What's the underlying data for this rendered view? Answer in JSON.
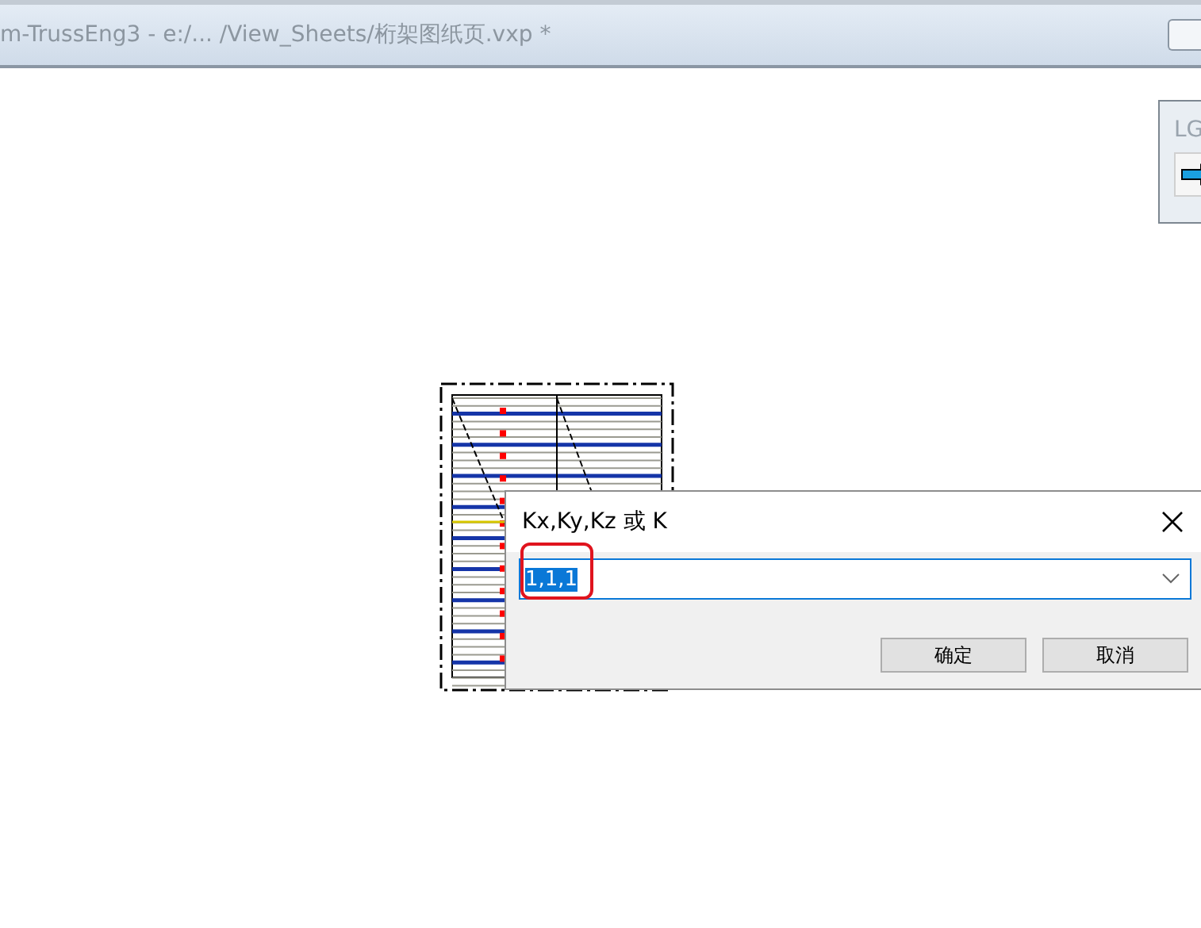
{
  "window": {
    "title": "m-TrussEng3 - e:/... /View_Sheets/桁架图纸页.vxp *"
  },
  "side_panel": {
    "label": "LG"
  },
  "dialog": {
    "title": "Kx,Ky,Kz 或 K",
    "field": {
      "value": "1,1,1",
      "value_selected": true,
      "highlighted": true
    },
    "buttons": [
      {
        "label": "确定"
      },
      {
        "label": "取消"
      }
    ]
  }
}
